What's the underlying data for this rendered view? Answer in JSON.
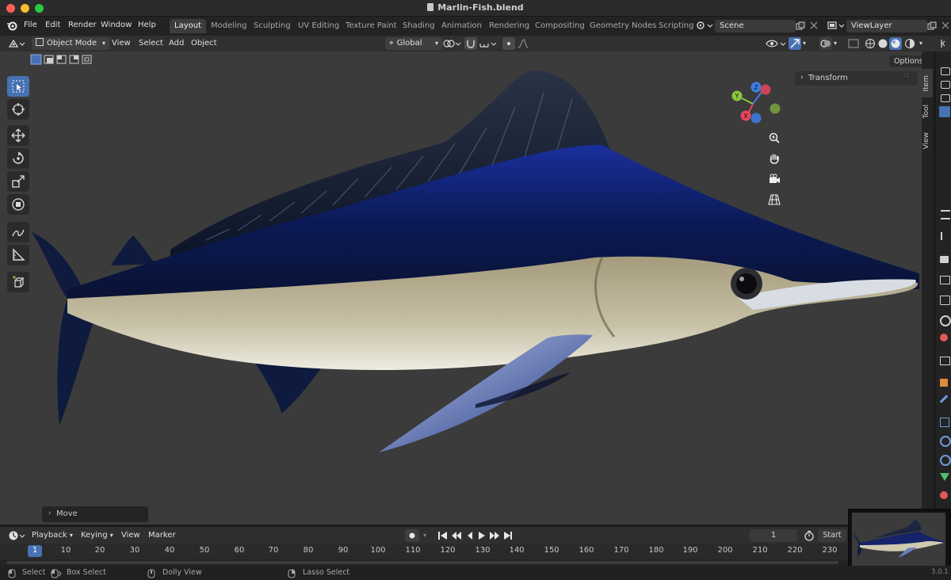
{
  "window": {
    "title": "Marlin-Fish.blend"
  },
  "menu": [
    "File",
    "Edit",
    "Render",
    "Window",
    "Help"
  ],
  "workspaces": [
    {
      "label": "Layout",
      "active": true
    },
    {
      "label": "Modeling"
    },
    {
      "label": "Sculpting"
    },
    {
      "label": "UV Editing"
    },
    {
      "label": "Texture Paint"
    },
    {
      "label": "Shading"
    },
    {
      "label": "Animation"
    },
    {
      "label": "Rendering"
    },
    {
      "label": "Compositing"
    },
    {
      "label": "Geometry Nodes"
    },
    {
      "label": "Scripting"
    }
  ],
  "scene": {
    "name": "Scene"
  },
  "view_layer": {
    "name": "ViewLayer"
  },
  "header": {
    "mode": "Object Mode",
    "menus": [
      "View",
      "Select",
      "Add",
      "Object"
    ],
    "transform_orientation": "Global",
    "options_label": "Options"
  },
  "sidebar": {
    "tabs": [
      "Item",
      "Tool",
      "View"
    ],
    "panel_title": "Transform"
  },
  "gizmo": {
    "axes": {
      "x": "X",
      "y": "Y",
      "z": "Z"
    }
  },
  "operator_panel": {
    "label": "Move"
  },
  "timeline": {
    "menus": [
      "Playback",
      "Keying",
      "View",
      "Marker"
    ],
    "current_frame": "1",
    "start_label": "Start",
    "ruler": [
      "1",
      "10",
      "20",
      "30",
      "40",
      "50",
      "60",
      "70",
      "80",
      "90",
      "100",
      "110",
      "120",
      "130",
      "140",
      "150",
      "160",
      "170",
      "180",
      "190",
      "200",
      "210",
      "220",
      "230"
    ]
  },
  "statusbar": {
    "items": [
      "Select",
      "Box Select",
      "Dolly View",
      "Lasso Select"
    ],
    "version": "3.0.1"
  },
  "colors": {
    "accent": "#4772b3",
    "viewport_bg": "#3b3b3b",
    "axis_x": "#e6475a",
    "axis_y": "#8bc43f",
    "axis_z": "#3f7ee6"
  }
}
